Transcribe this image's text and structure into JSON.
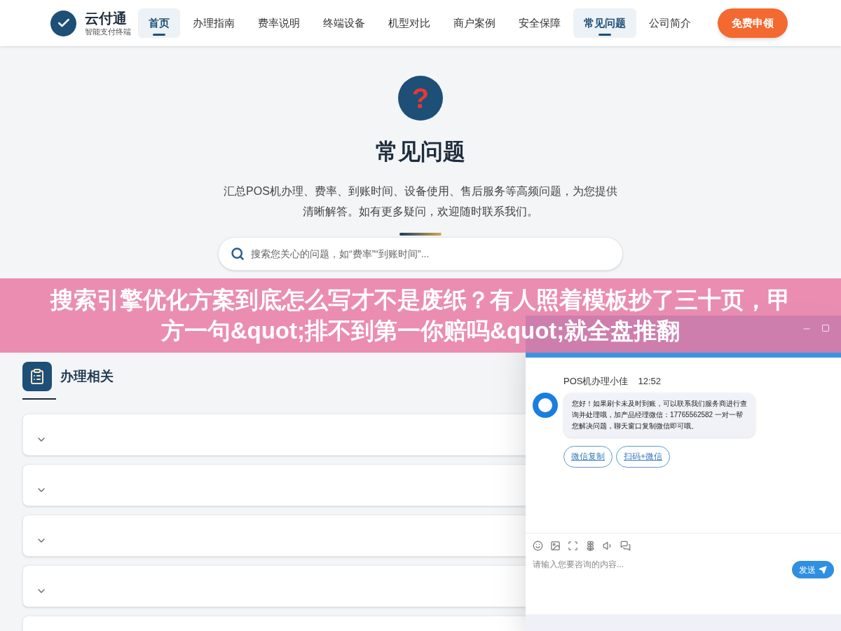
{
  "header": {
    "logo": {
      "name": "云付通",
      "tagline": "智能支付终端"
    },
    "nav": [
      {
        "label": "首页",
        "selected": true
      },
      {
        "label": "办理指南",
        "selected": false
      },
      {
        "label": "费率说明",
        "selected": false
      },
      {
        "label": "终端设备",
        "selected": false
      },
      {
        "label": "机型对比",
        "selected": false
      },
      {
        "label": "商户案例",
        "selected": false
      },
      {
        "label": "安全保障",
        "selected": false
      },
      {
        "label": "常见问题",
        "selected": true
      },
      {
        "label": "公司简介",
        "selected": false
      }
    ],
    "cta": "免费申领"
  },
  "hero": {
    "icon_glyph": "?",
    "title": "常见问题",
    "description": "汇总POS机办理、费率、到账时间、设备使用、售后服务等高频问题，为您提供清晰解答。如有更多疑问，欢迎随时联系我们。",
    "search": {
      "placeholder": "搜索您关心的问题，如“费率”“到账时间”..."
    }
  },
  "banner": {
    "text": "搜索引擎优化方案到底怎么写才不是废纸？有人照着模板抄了三十页，甲方一句&quot;排不到第一你赔吗&quot;就全盘推翻"
  },
  "section": {
    "title": "办理相关",
    "faq_items": [
      {
        "expanded": false
      },
      {
        "expanded": false
      },
      {
        "expanded": false
      },
      {
        "expanded": false
      },
      {
        "kind": "partial"
      }
    ]
  },
  "chat": {
    "agent": "POS机办理小佳",
    "time": "12:52",
    "message": "您好！如果刷卡未及时到账，可以联系我们服务商进行查询并处理哦，加产品经理微信：17765562582 一对一帮您解决问题，聊天窗口复制微信即可哦。",
    "actions": [
      "微信复制",
      "扫码+微信"
    ],
    "input": {
      "placeholder": "请输入您要咨询的内容..."
    },
    "send": "发送"
  }
}
